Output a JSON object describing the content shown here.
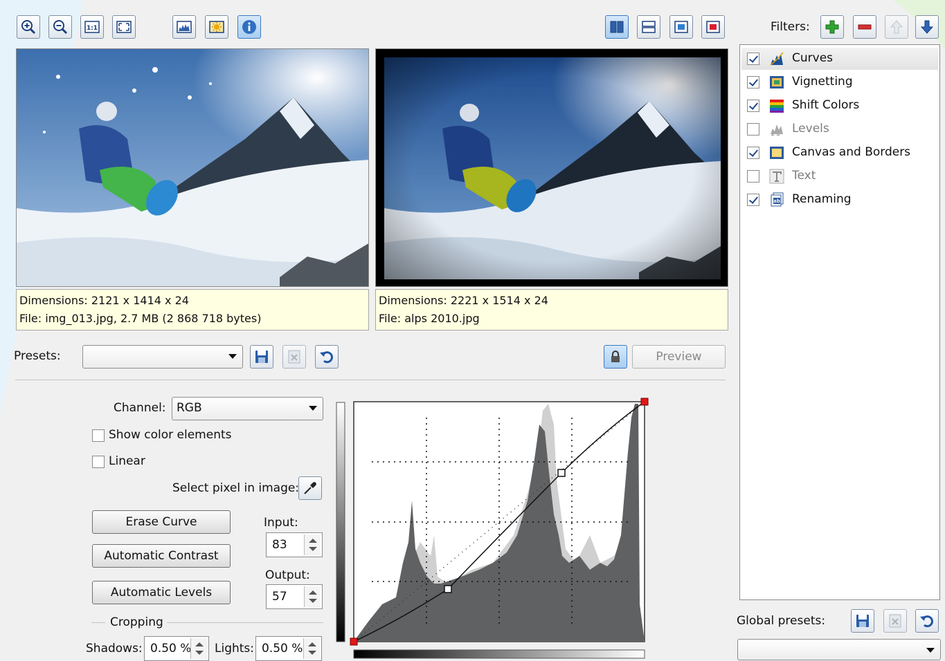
{
  "toolbar": {
    "zoom_in": "zoom-in",
    "zoom_out": "zoom-out",
    "actual": "1:1",
    "fit": "fit"
  },
  "left_image": {
    "dimensions": "Dimensions: 2121 x 1414 x 24",
    "file": "File: img_013.jpg, 2.7 MB (2 868 718 bytes)"
  },
  "right_image": {
    "dimensions": "Dimensions: 2221 x 1514 x 24",
    "file": "File: alps 2010.jpg"
  },
  "presets": {
    "label": "Presets:",
    "value": ""
  },
  "preview_label": "Preview",
  "curves": {
    "channel_label": "Channel:",
    "channel_value": "RGB",
    "show_color_elements": "Show color elements",
    "linear": "Linear",
    "select_pixel": "Select pixel in image:",
    "erase_curve": "Erase Curve",
    "automatic_contrast": "Automatic Contrast",
    "automatic_levels": "Automatic Levels",
    "input_label": "Input:",
    "input_value": "83",
    "output_label": "Output:",
    "output_value": "57",
    "cropping_label": "Cropping",
    "shadows_label": "Shadows:",
    "shadows_value": "0.50 %",
    "lights_label": "Lights:",
    "lights_value": "0.50 %"
  },
  "filters": {
    "label": "Filters:",
    "items": [
      {
        "label": "Curves",
        "checked": true,
        "icon": "curves-icon"
      },
      {
        "label": "Vignetting",
        "checked": true,
        "icon": "vignetting-icon"
      },
      {
        "label": "Shift Colors",
        "checked": true,
        "icon": "shift-colors-icon"
      },
      {
        "label": "Levels",
        "checked": false,
        "icon": "levels-icon"
      },
      {
        "label": "Canvas and Borders",
        "checked": true,
        "icon": "canvas-borders-icon"
      },
      {
        "label": "Text",
        "checked": false,
        "icon": "text-icon"
      },
      {
        "label": "Renaming",
        "checked": true,
        "icon": "renaming-icon"
      }
    ]
  },
  "global_presets": {
    "label": "Global presets:",
    "value": ""
  },
  "colors": {
    "accent": "#3d7bbf",
    "highlight": "#ffffe1",
    "curve_point": "#e01818"
  }
}
